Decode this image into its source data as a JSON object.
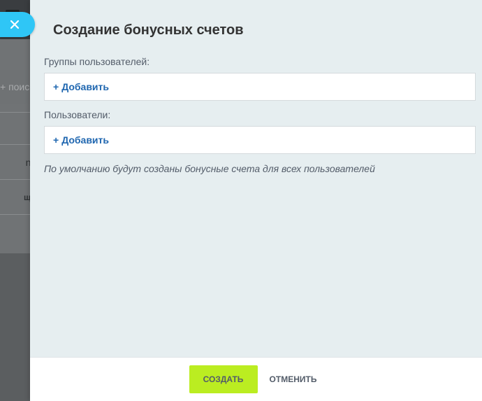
{
  "background": {
    "search_text": "+ поис",
    "row_admin_text": "nin)",
    "row_bold_text": "щая"
  },
  "close_button": {
    "icon": "close-icon"
  },
  "panel": {
    "title": "Создание бонусных счетов",
    "fields": [
      {
        "label": "Группы пользователей:",
        "add_label": "Добавить",
        "add_plus": "+"
      },
      {
        "label": "Пользователи:",
        "add_label": "Добавить",
        "add_plus": "+"
      }
    ],
    "hint": "По умолчанию будут созданы бонусные счета для всех пользователей"
  },
  "footer": {
    "create_label": "СОЗДАТЬ",
    "cancel_label": "ОТМЕНИТЬ"
  },
  "colors": {
    "accent_close": "#2fc6f6",
    "create_button": "#bbed21",
    "link": "#2067b0",
    "panel_bg": "#e6eef0"
  }
}
